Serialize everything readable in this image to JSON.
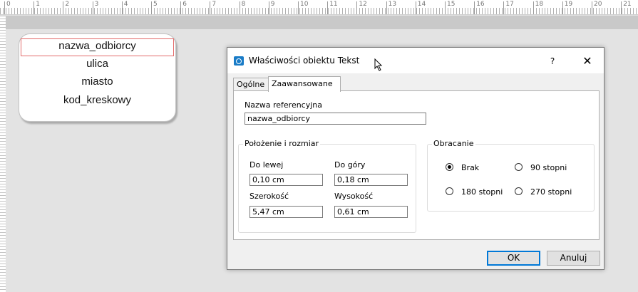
{
  "ruler": {
    "numbers": [
      "0",
      "1",
      "2",
      "3",
      "4",
      "5",
      "6",
      "7",
      "8",
      "9",
      "10",
      "11",
      "12",
      "13",
      "14",
      "15",
      "16",
      "17",
      "18",
      "19",
      "20",
      "21",
      "22"
    ]
  },
  "label_preview": {
    "lines": [
      "nazwa_odbiorcy",
      "ulica",
      "miasto",
      "kod_kreskowy"
    ]
  },
  "dialog": {
    "title": "Właściwości obiektu Tekst",
    "help": "?",
    "close": "✕",
    "tabs": [
      {
        "label": "Ogólne"
      },
      {
        "label": "Zaawansowane"
      }
    ],
    "ref_name": {
      "label": "Nazwa referencyjna",
      "value": "nazwa_odbiorcy"
    },
    "position_group": {
      "title": "Położenie i rozmiar",
      "left_label": "Do lewej",
      "left_value": "0,10 cm",
      "top_label": "Do góry",
      "top_value": "0,18 cm",
      "width_label": "Szerokość",
      "width_value": "5,47 cm",
      "height_label": "Wysokość",
      "height_value": "0,61 cm"
    },
    "rotation_group": {
      "title": "Obracanie",
      "options": [
        {
          "label": "Brak",
          "checked": true
        },
        {
          "label": "90 stopni",
          "checked": false
        },
        {
          "label": "180 stopni",
          "checked": false
        },
        {
          "label": "270 stopni",
          "checked": false
        }
      ]
    },
    "ok": "OK",
    "cancel": "Anuluj"
  }
}
